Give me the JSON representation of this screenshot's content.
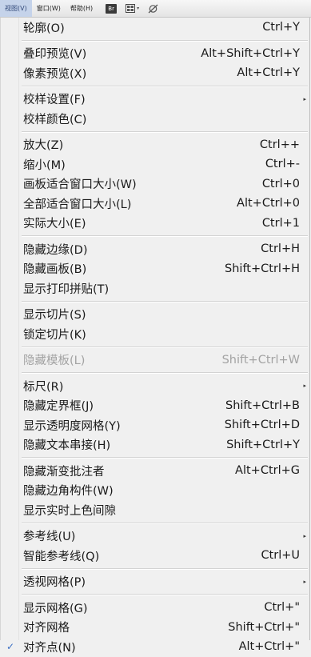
{
  "menubar": {
    "view": "视图(V)",
    "window": "窗口(W)",
    "help": "帮助(H)",
    "bridge_icon": "Br",
    "arrange_icon": "arrange-documents-icon",
    "workspace_icon": "workspace-icon",
    "caret": "▾"
  },
  "menu": {
    "items": [
      {
        "label": "轮廓(O)",
        "shortcut": "Ctrl+Y"
      },
      {
        "sep": true
      },
      {
        "label": "叠印预览(V)",
        "shortcut": "Alt+Shift+Ctrl+Y"
      },
      {
        "label": "像素预览(X)",
        "shortcut": "Alt+Ctrl+Y"
      },
      {
        "sep": true
      },
      {
        "label": "校样设置(F)",
        "submenu": true
      },
      {
        "label": "校样颜色(C)"
      },
      {
        "sep": true
      },
      {
        "label": "放大(Z)",
        "shortcut": "Ctrl++"
      },
      {
        "label": "缩小(M)",
        "shortcut": "Ctrl+-"
      },
      {
        "label": "画板适合窗口大小(W)",
        "shortcut": "Ctrl+0"
      },
      {
        "label": "全部适合窗口大小(L)",
        "shortcut": "Alt+Ctrl+0"
      },
      {
        "label": "实际大小(E)",
        "shortcut": "Ctrl+1"
      },
      {
        "sep": true
      },
      {
        "label": "隐藏边缘(D)",
        "shortcut": "Ctrl+H"
      },
      {
        "label": "隐藏画板(B)",
        "shortcut": "Shift+Ctrl+H"
      },
      {
        "label": "显示打印拼贴(T)"
      },
      {
        "sep": true
      },
      {
        "label": "显示切片(S)"
      },
      {
        "label": "锁定切片(K)"
      },
      {
        "sep": true
      },
      {
        "label": "隐藏模板(L)",
        "shortcut": "Shift+Ctrl+W",
        "disabled": true
      },
      {
        "sep": true
      },
      {
        "label": "标尺(R)",
        "submenu": true
      },
      {
        "label": "隐藏定界框(J)",
        "shortcut": "Shift+Ctrl+B"
      },
      {
        "label": "显示透明度网格(Y)",
        "shortcut": "Shift+Ctrl+D"
      },
      {
        "label": "隐藏文本串接(H)",
        "shortcut": "Shift+Ctrl+Y"
      },
      {
        "sep": true
      },
      {
        "label": "隐藏渐变批注者",
        "shortcut": "Alt+Ctrl+G"
      },
      {
        "label": "隐藏边角构件(W)"
      },
      {
        "label": "显示实时上色间隙"
      },
      {
        "sep": true
      },
      {
        "label": "参考线(U)",
        "submenu": true
      },
      {
        "label": "智能参考线(Q)",
        "shortcut": "Ctrl+U"
      },
      {
        "sep": true
      },
      {
        "label": "透视网格(P)",
        "submenu": true
      },
      {
        "sep": true
      },
      {
        "label": "显示网格(G)",
        "shortcut": "Ctrl+\""
      },
      {
        "label": "对齐网格",
        "shortcut": "Shift+Ctrl+\""
      },
      {
        "label": "对齐点(N)",
        "shortcut": "Alt+Ctrl+\"",
        "checked": true
      }
    ]
  },
  "glyphs": {
    "check": "✓",
    "submenu_arrow": "▸"
  }
}
